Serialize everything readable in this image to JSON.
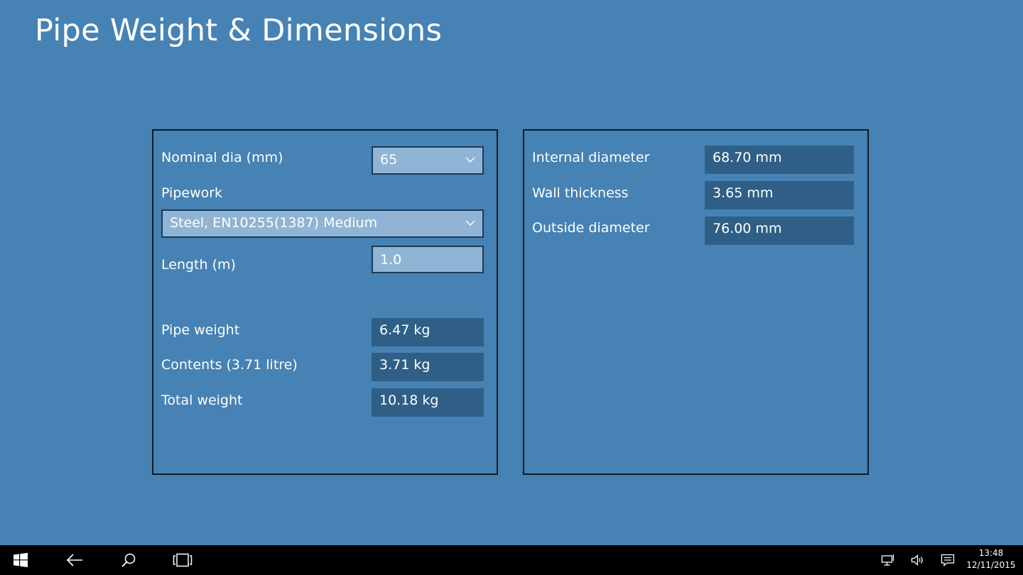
{
  "app": {
    "title": "Pipe Weight & Dimensions"
  },
  "inputs": {
    "nominal_dia_label": "Nominal dia (mm)",
    "nominal_dia_value": "65",
    "pipework_label": "Pipework",
    "pipework_value": "Steel, EN10255(1387) Medium",
    "length_label": "Length (m)",
    "length_value": "1.0"
  },
  "weights": {
    "pipe_weight_label": "Pipe weight",
    "pipe_weight_value": "6.47 kg",
    "contents_label": "Contents (3.71 litre)",
    "contents_value": "3.71 kg",
    "total_weight_label": "Total weight",
    "total_weight_value": "10.18 kg"
  },
  "dimensions": {
    "internal_diameter_label": "Internal diameter",
    "internal_diameter_value": "68.70 mm",
    "wall_thickness_label": "Wall thickness",
    "wall_thickness_value": "3.65 mm",
    "outside_diameter_label": "Outside diameter",
    "outside_diameter_value": "76.00 mm"
  },
  "taskbar": {
    "icons": [
      "windows-start-icon",
      "back-arrow-icon",
      "search-icon",
      "task-view-icon",
      "network-icon",
      "volume-icon",
      "action-center-icon"
    ],
    "time": "13:48",
    "date": "12/11/2015"
  },
  "colors": {
    "background": "#4682b4",
    "input_fill": "#8fb4d5",
    "output_fill": "#2f5f86",
    "panel_border": "#0f1a26",
    "taskbar": "#000000"
  }
}
